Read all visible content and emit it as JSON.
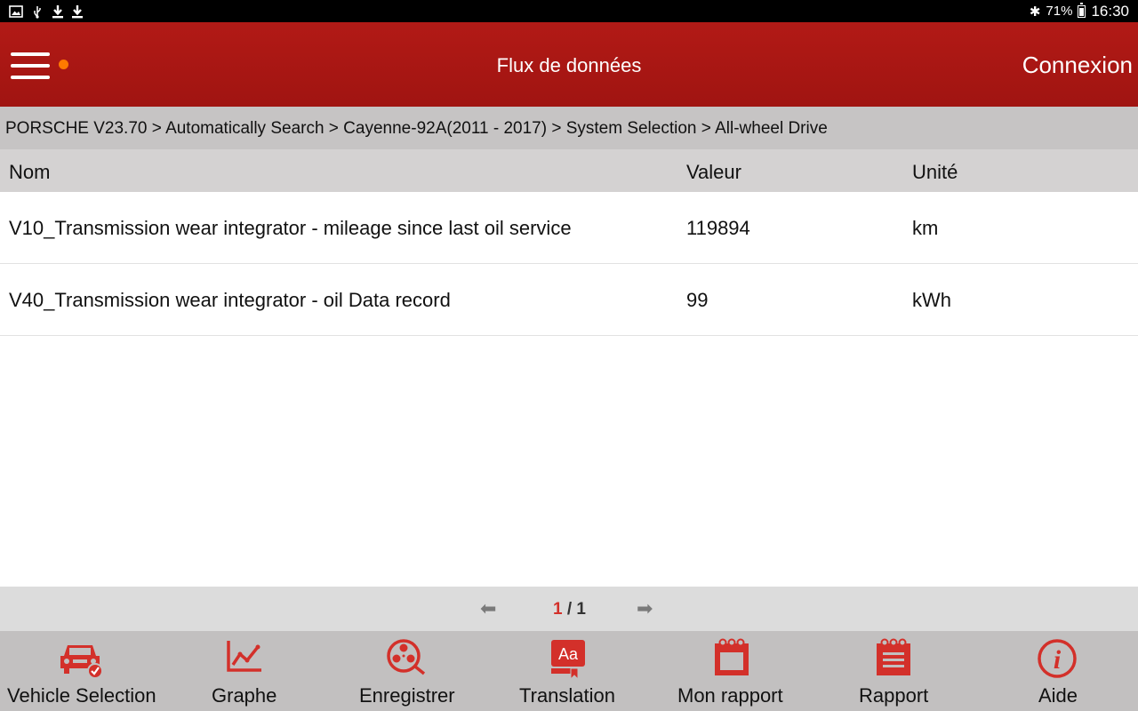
{
  "status_bar": {
    "battery": "71%",
    "time": "16:30",
    "icons": [
      "image-icon",
      "usb-icon",
      "download-icon",
      "download-icon",
      "bluetooth-icon",
      "battery-icon"
    ]
  },
  "header": {
    "title": "Flux de données",
    "connect_label": "Connexion",
    "accent_color": "#a81713",
    "notification_dot_color": "#ff7a00"
  },
  "breadcrumb": "PORSCHE V23.70 > Automatically Search > Cayenne-92A(2011 - 2017) > System Selection > All-wheel Drive",
  "table": {
    "columns": [
      "Nom",
      "Valeur",
      "Unité"
    ],
    "rows": [
      {
        "name": "V10_Transmission wear integrator - mileage since last oil service",
        "value": "119894",
        "unit": "km"
      },
      {
        "name": "V40_Transmission wear integrator - oil Data record",
        "value": "99",
        "unit": "kWh"
      }
    ]
  },
  "pagination": {
    "current": "1",
    "separator": "/",
    "total": "1"
  },
  "toolbar": {
    "items": [
      {
        "label": "Vehicle Selection",
        "icon": "car-check-icon"
      },
      {
        "label": "Graphe",
        "icon": "graph-icon"
      },
      {
        "label": "Enregistrer",
        "icon": "record-reel-icon"
      },
      {
        "label": "Translation",
        "icon": "translation-icon"
      },
      {
        "label": "Mon rapport",
        "icon": "calendar-report-icon"
      },
      {
        "label": "Rapport",
        "icon": "report-icon"
      },
      {
        "label": "Aide",
        "icon": "info-icon"
      }
    ],
    "icon_color": "#d3302a"
  }
}
